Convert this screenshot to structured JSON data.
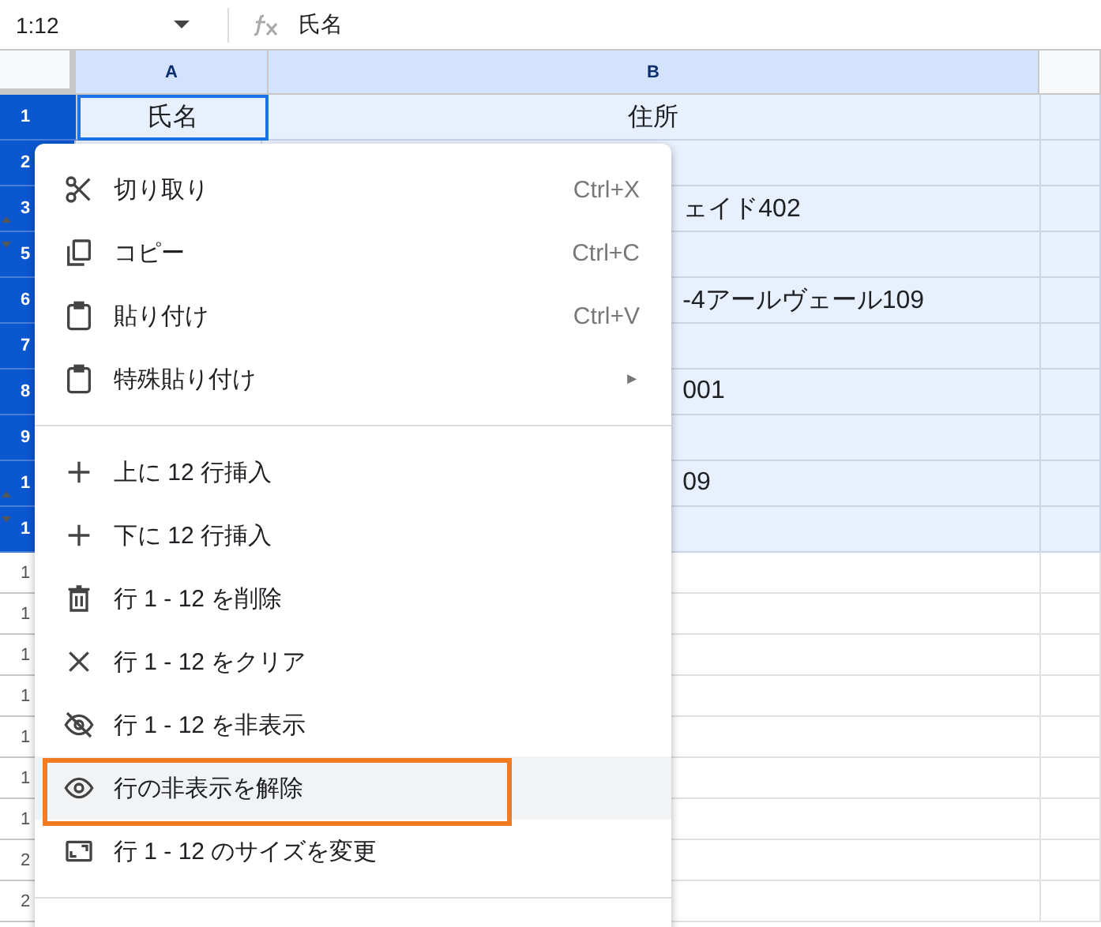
{
  "formula_bar": {
    "name_box": "1:12",
    "formula": "氏名"
  },
  "columns": [
    {
      "selected": false
    },
    {
      "label": "A",
      "selected": true
    },
    {
      "label": "B",
      "selected": true
    },
    {
      "selected": false
    }
  ],
  "rows": [
    {
      "header": "1",
      "selected": true,
      "a": "氏名",
      "b": "住所"
    },
    {
      "header": "2",
      "selected": true
    },
    {
      "header": "3",
      "selected": true,
      "hidden_after": true,
      "b": "ェイド402"
    },
    {
      "header": "5",
      "selected": true
    },
    {
      "header": "6",
      "selected": true,
      "b": "-4アールヴェール109"
    },
    {
      "header": "7",
      "selected": true
    },
    {
      "header": "8",
      "selected": true,
      "b": "001"
    },
    {
      "header": "9",
      "selected": true
    },
    {
      "header": "1",
      "selected": true,
      "hidden_after": true,
      "b": "09"
    },
    {
      "header": "1",
      "selected": true
    },
    {
      "header": "1",
      "selected": false
    },
    {
      "header": "1",
      "selected": false
    },
    {
      "header": "1",
      "selected": false
    },
    {
      "header": "1",
      "selected": false
    },
    {
      "header": "1",
      "selected": false
    },
    {
      "header": "1",
      "selected": false
    },
    {
      "header": "1",
      "selected": false
    },
    {
      "header": "2",
      "selected": false
    },
    {
      "header": "2",
      "selected": false
    }
  ],
  "context_menu": [
    {
      "kind": "item",
      "label": "切り取り",
      "shortcut": "Ctrl+X",
      "highlighted": false
    },
    {
      "kind": "item",
      "label": "コピー",
      "shortcut": "Ctrl+C",
      "highlighted": false
    },
    {
      "kind": "item",
      "label": "貼り付け",
      "shortcut": "Ctrl+V",
      "highlighted": false
    },
    {
      "kind": "item",
      "label": "特殊貼り付け",
      "submenu_arrow": "►",
      "highlighted": false
    },
    {
      "kind": "divider"
    },
    {
      "kind": "item",
      "label": "上に 12 行挿入",
      "highlighted": false
    },
    {
      "kind": "item",
      "label": "下に 12 行挿入",
      "highlighted": false
    },
    {
      "kind": "item",
      "label": "行 1 - 12 を削除",
      "highlighted": false
    },
    {
      "kind": "item",
      "label": "行 1 - 12 をクリア",
      "highlighted": false
    },
    {
      "kind": "item",
      "label": "行 1 - 12 を非表示",
      "highlighted": false
    },
    {
      "kind": "item",
      "label": "行の非表示を解除",
      "highlighted": true
    },
    {
      "kind": "item",
      "label": "行 1 - 12 のサイズを変更",
      "highlighted": false
    },
    {
      "kind": "divider"
    }
  ]
}
